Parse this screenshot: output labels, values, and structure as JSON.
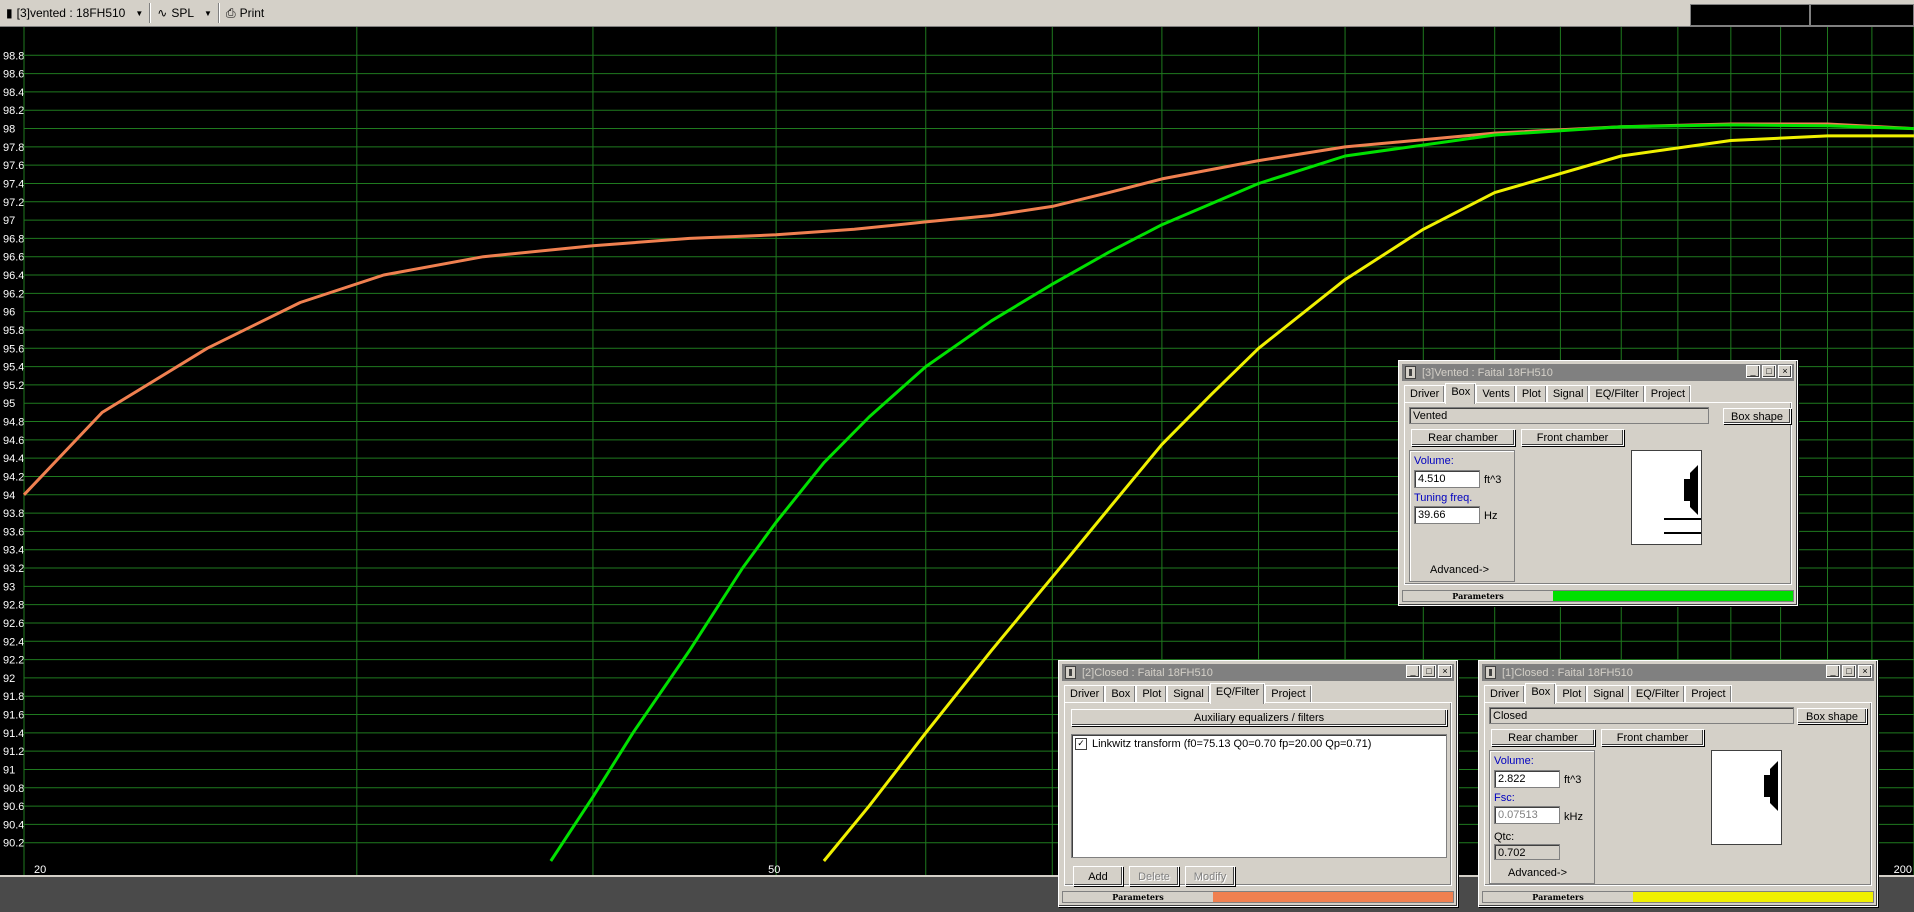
{
  "toolbar": {
    "project_label": "[3]vented : 18FH510",
    "plot_label": "SPL",
    "print_label": "Print"
  },
  "chart_data": {
    "type": "line",
    "x_scale": "log",
    "xlim": [
      20,
      200
    ],
    "ylim": [
      90.0,
      99.0
    ],
    "x_tick_labels": [
      "20",
      "50",
      "200"
    ],
    "y_tick_labels": [
      "98.8",
      "98.6",
      "98.4",
      "98.2",
      "98",
      "97.8",
      "97.6",
      "97.4",
      "97.2",
      "97",
      "96.8",
      "96.6",
      "96.4",
      "96.2",
      "96",
      "95.8",
      "95.6",
      "95.4",
      "95.2",
      "95",
      "94.8",
      "94.6",
      "94.4",
      "94.2",
      "94",
      "93.8",
      "93.6",
      "93.4",
      "93.2",
      "93",
      "92.8",
      "92.6",
      "92.4",
      "92.2",
      "92",
      "91.8",
      "91.6",
      "91.4",
      "91.2",
      "91",
      "90.8",
      "90.6",
      "90.4",
      "90.2"
    ],
    "grid": true,
    "series": [
      {
        "color": "#f08050",
        "x": [
          20,
          22,
          25,
          28,
          31,
          35,
          40,
          45,
          50,
          55,
          60,
          65,
          70,
          75,
          80,
          90,
          100,
          120,
          140,
          160,
          180,
          200
        ],
        "y": [
          94.0,
          94.9,
          95.6,
          96.1,
          96.4,
          96.6,
          96.72,
          96.8,
          96.84,
          96.9,
          96.98,
          97.05,
          97.15,
          97.3,
          97.45,
          97.65,
          97.8,
          97.95,
          98.02,
          98.05,
          98.05,
          98.0
        ]
      },
      {
        "color": "#00e000",
        "x": [
          38,
          40,
          42,
          45,
          48,
          50,
          53,
          56,
          60,
          65,
          70,
          75,
          80,
          90,
          100,
          120,
          140,
          160,
          180,
          200
        ],
        "y": [
          90.0,
          90.7,
          91.4,
          92.3,
          93.2,
          93.7,
          94.35,
          94.85,
          95.4,
          95.9,
          96.3,
          96.65,
          96.95,
          97.4,
          97.7,
          97.93,
          98.02,
          98.04,
          98.03,
          98.0
        ]
      },
      {
        "color": "#f0f000",
        "x": [
          53,
          56,
          60,
          65,
          70,
          75,
          80,
          85,
          90,
          100,
          110,
          120,
          140,
          160,
          180,
          200
        ],
        "y": [
          90.0,
          90.6,
          91.4,
          92.3,
          93.1,
          93.85,
          94.55,
          95.1,
          95.6,
          96.35,
          96.9,
          97.3,
          97.7,
          97.87,
          97.92,
          97.92
        ]
      }
    ]
  },
  "windows": {
    "vented": {
      "title": "[3]Vented : Faital 18FH510",
      "tabs": [
        "Driver",
        "Box",
        "Vents",
        "Plot",
        "Signal",
        "EQ/Filter",
        "Project"
      ],
      "active_tab": "Box",
      "type_text": "Vented",
      "box_shape_button": "Box shape",
      "rear_chamber_button": "Rear chamber",
      "front_chamber_button": "Front chamber",
      "volume_label": "Volume:",
      "volume_value": "4.510",
      "volume_unit": "ft^3",
      "tuning_label": "Tuning freq.",
      "tuning_value": "39.66",
      "tuning_unit": "Hz",
      "advanced_label": "Advanced->",
      "parameters_label": "Parameters",
      "accent_color": "#00e000"
    },
    "closed2": {
      "title": "[2]Closed : Faital 18FH510",
      "tabs": [
        "Driver",
        "Box",
        "Plot",
        "Signal",
        "EQ/Filter",
        "Project"
      ],
      "active_tab": "EQ/Filter",
      "aux_button": "Auxiliary equalizers / filters",
      "filter_item": "Linkwitz transform (f0=75.13 Q0=0.70 fp=20.00 Qp=0.71)",
      "filter_checked": true,
      "add_button": "Add",
      "delete_button": "Delete",
      "modify_button": "Modify",
      "parameters_label": "Parameters",
      "accent_color": "#f08050"
    },
    "closed1": {
      "title": "[1]Closed : Faital 18FH510",
      "tabs": [
        "Driver",
        "Box",
        "Plot",
        "Signal",
        "EQ/Filter",
        "Project"
      ],
      "active_tab": "Box",
      "type_text": "Closed",
      "box_shape_button": "Box shape",
      "rear_chamber_button": "Rear chamber",
      "front_chamber_button": "Front chamber",
      "volume_label": "Volume:",
      "volume_value": "2.822",
      "volume_unit": "ft^3",
      "fsc_label": "Fsc:",
      "fsc_value": "0.07513",
      "fsc_unit": "kHz",
      "qtc_label": "Qtc:",
      "qtc_value": "0.702",
      "advanced_label": "Advanced->",
      "parameters_label": "Parameters",
      "accent_color": "#f0f000"
    }
  }
}
